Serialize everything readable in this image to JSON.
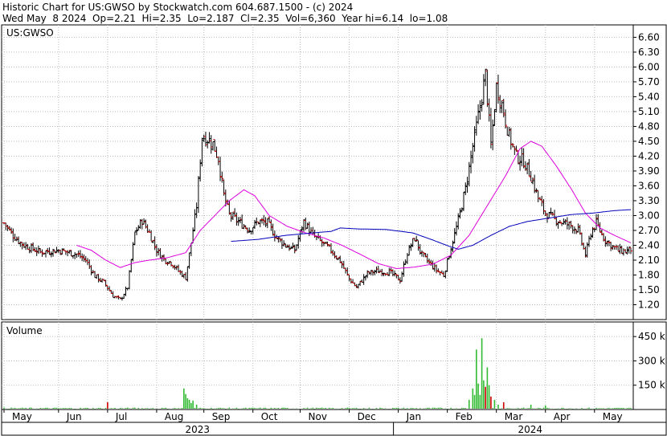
{
  "header": {
    "line1": "Historic Chart for US:GWSO by Stockwatch.com 604.687.1500 - (c) 2024",
    "line2": "Wed May  8 2024  Op=2.21  Hi=2.35  Lo=2.187  Cl=2.35  Vol=6,360  Year hi=6.14  lo=1.08"
  },
  "chart_data": {
    "type": "candlestick",
    "symbol_label": "US:GWSO",
    "volume_label": "Volume",
    "price_axis": {
      "ticks": [
        1.2,
        1.5,
        1.8,
        2.1,
        2.4,
        2.7,
        3.0,
        3.3,
        3.6,
        3.9,
        4.2,
        4.5,
        4.8,
        5.1,
        5.4,
        5.7,
        6.0,
        6.3,
        6.6
      ],
      "tick_labels": [
        "1.20",
        "1.50",
        "1.80",
        "2.10",
        "2.40",
        "2.70",
        "3.00",
        "3.30",
        "3.60",
        "3.90",
        "4.20",
        "4.50",
        "4.80",
        "5.10",
        "5.40",
        "5.70",
        "6.00",
        "6.30",
        "6.60"
      ],
      "range": [
        0.9,
        6.85
      ]
    },
    "volume_axis": {
      "ticks": [
        150000,
        300000,
        450000
      ],
      "tick_labels": [
        "150 k",
        "300 k",
        "450 k"
      ],
      "range": [
        0,
        540000
      ]
    },
    "months": [
      "May",
      "Jun",
      "Jul",
      "Aug",
      "Sep",
      "Oct",
      "Nov",
      "Dec",
      "Jan",
      "Feb",
      "Mar",
      "Apr",
      "May"
    ],
    "years": [
      "2023",
      "2024"
    ],
    "colors": {
      "up": "#000000",
      "down": "#cc0000",
      "ma_short": "#dd00dd",
      "ma_long": "#0000bb",
      "volume": "#33bb33",
      "volume_down": "#cc0000",
      "grid": "#bbbbbb"
    },
    "price_anchors": [
      [
        0,
        2.85
      ],
      [
        5,
        2.6
      ],
      [
        10,
        2.42
      ],
      [
        20,
        2.26
      ],
      [
        30,
        2.3
      ],
      [
        40,
        2.22
      ],
      [
        45,
        2.1
      ],
      [
        50,
        1.78
      ],
      [
        55,
        1.65
      ],
      [
        60,
        1.38
      ],
      [
        64,
        1.3
      ],
      [
        68,
        1.55
      ],
      [
        72,
        2.65
      ],
      [
        76,
        2.9
      ],
      [
        80,
        2.65
      ],
      [
        84,
        2.3
      ],
      [
        88,
        2.12
      ],
      [
        92,
        2.05
      ],
      [
        96,
        1.88
      ],
      [
        100,
        1.75
      ],
      [
        103,
        2.45
      ],
      [
        106,
        3.2
      ],
      [
        109,
        4.6
      ],
      [
        112,
        4.55
      ],
      [
        115,
        4.45
      ],
      [
        118,
        4.15
      ],
      [
        121,
        3.4
      ],
      [
        124,
        3.02
      ],
      [
        130,
        2.85
      ],
      [
        135,
        2.72
      ],
      [
        140,
        2.88
      ],
      [
        145,
        2.85
      ],
      [
        150,
        2.55
      ],
      [
        155,
        2.4
      ],
      [
        160,
        2.3
      ],
      [
        165,
        2.88
      ],
      [
        170,
        2.6
      ],
      [
        175,
        2.45
      ],
      [
        180,
        2.3
      ],
      [
        185,
        2.08
      ],
      [
        190,
        1.72
      ],
      [
        194,
        1.55
      ],
      [
        200,
        1.83
      ],
      [
        205,
        1.88
      ],
      [
        212,
        1.86
      ],
      [
        218,
        1.7
      ],
      [
        222,
        2.25
      ],
      [
        226,
        2.55
      ],
      [
        230,
        2.2
      ],
      [
        234,
        2.05
      ],
      [
        238,
        1.9
      ],
      [
        242,
        1.8
      ],
      [
        246,
        2.35
      ],
      [
        250,
        2.9
      ],
      [
        254,
        3.55
      ],
      [
        258,
        4.4
      ],
      [
        262,
        5.2
      ],
      [
        265,
        5.85
      ],
      [
        268,
        4.4
      ],
      [
        271,
        5.6
      ],
      [
        274,
        5.25
      ],
      [
        278,
        4.6
      ],
      [
        282,
        4.2
      ],
      [
        286,
        4.1
      ],
      [
        290,
        3.8
      ],
      [
        294,
        3.35
      ],
      [
        298,
        3.05
      ],
      [
        302,
        2.95
      ],
      [
        306,
        2.88
      ],
      [
        312,
        2.8
      ],
      [
        316,
        2.7
      ],
      [
        320,
        2.2
      ],
      [
        323,
        2.65
      ],
      [
        326,
        2.85
      ],
      [
        330,
        2.55
      ],
      [
        334,
        2.4
      ],
      [
        338,
        2.3
      ],
      [
        342,
        2.28
      ],
      [
        345,
        2.32
      ]
    ],
    "ma_short_anchors": [
      [
        40,
        2.4
      ],
      [
        48,
        2.3
      ],
      [
        56,
        2.1
      ],
      [
        64,
        1.95
      ],
      [
        72,
        2.05
      ],
      [
        80,
        2.1
      ],
      [
        90,
        2.15
      ],
      [
        100,
        2.25
      ],
      [
        108,
        2.7
      ],
      [
        116,
        3.0
      ],
      [
        124,
        3.3
      ],
      [
        132,
        3.52
      ],
      [
        138,
        3.4
      ],
      [
        146,
        3.0
      ],
      [
        156,
        2.78
      ],
      [
        166,
        2.65
      ],
      [
        176,
        2.55
      ],
      [
        186,
        2.4
      ],
      [
        196,
        2.22
      ],
      [
        206,
        2.03
      ],
      [
        216,
        1.93
      ],
      [
        226,
        1.96
      ],
      [
        236,
        2.02
      ],
      [
        246,
        2.2
      ],
      [
        256,
        2.6
      ],
      [
        266,
        3.2
      ],
      [
        276,
        3.8
      ],
      [
        284,
        4.35
      ],
      [
        290,
        4.5
      ],
      [
        296,
        4.4
      ],
      [
        304,
        4.0
      ],
      [
        312,
        3.55
      ],
      [
        320,
        3.05
      ],
      [
        328,
        2.75
      ],
      [
        336,
        2.6
      ],
      [
        345,
        2.45
      ]
    ],
    "ma_long_anchors": [
      [
        125,
        2.48
      ],
      [
        140,
        2.52
      ],
      [
        155,
        2.6
      ],
      [
        170,
        2.65
      ],
      [
        180,
        2.68
      ],
      [
        185,
        2.75
      ],
      [
        195,
        2.73
      ],
      [
        210,
        2.72
      ],
      [
        225,
        2.65
      ],
      [
        235,
        2.52
      ],
      [
        245,
        2.38
      ],
      [
        250,
        2.32
      ],
      [
        258,
        2.4
      ],
      [
        268,
        2.6
      ],
      [
        278,
        2.78
      ],
      [
        288,
        2.88
      ],
      [
        300,
        2.95
      ],
      [
        312,
        3.02
      ],
      [
        324,
        3.05
      ],
      [
        336,
        3.1
      ],
      [
        345,
        3.12
      ]
    ],
    "volume_spikes": [
      [
        57,
        45000
      ],
      [
        99,
        130000
      ],
      [
        100,
        95000
      ],
      [
        101,
        70000
      ],
      [
        102,
        60000
      ],
      [
        103,
        40000
      ],
      [
        104,
        55000
      ],
      [
        106,
        30000
      ],
      [
        256,
        60000
      ],
      [
        258,
        130000
      ],
      [
        259,
        90000
      ],
      [
        260,
        370000
      ],
      [
        261,
        160000
      ],
      [
        262,
        90000
      ],
      [
        263,
        440000
      ],
      [
        264,
        180000
      ],
      [
        265,
        140000
      ],
      [
        266,
        260000
      ],
      [
        267,
        150000
      ],
      [
        268,
        80000
      ],
      [
        270,
        60000
      ],
      [
        272,
        30000
      ],
      [
        275,
        45000
      ],
      [
        290,
        30000
      ],
      [
        298,
        25000
      ]
    ]
  }
}
